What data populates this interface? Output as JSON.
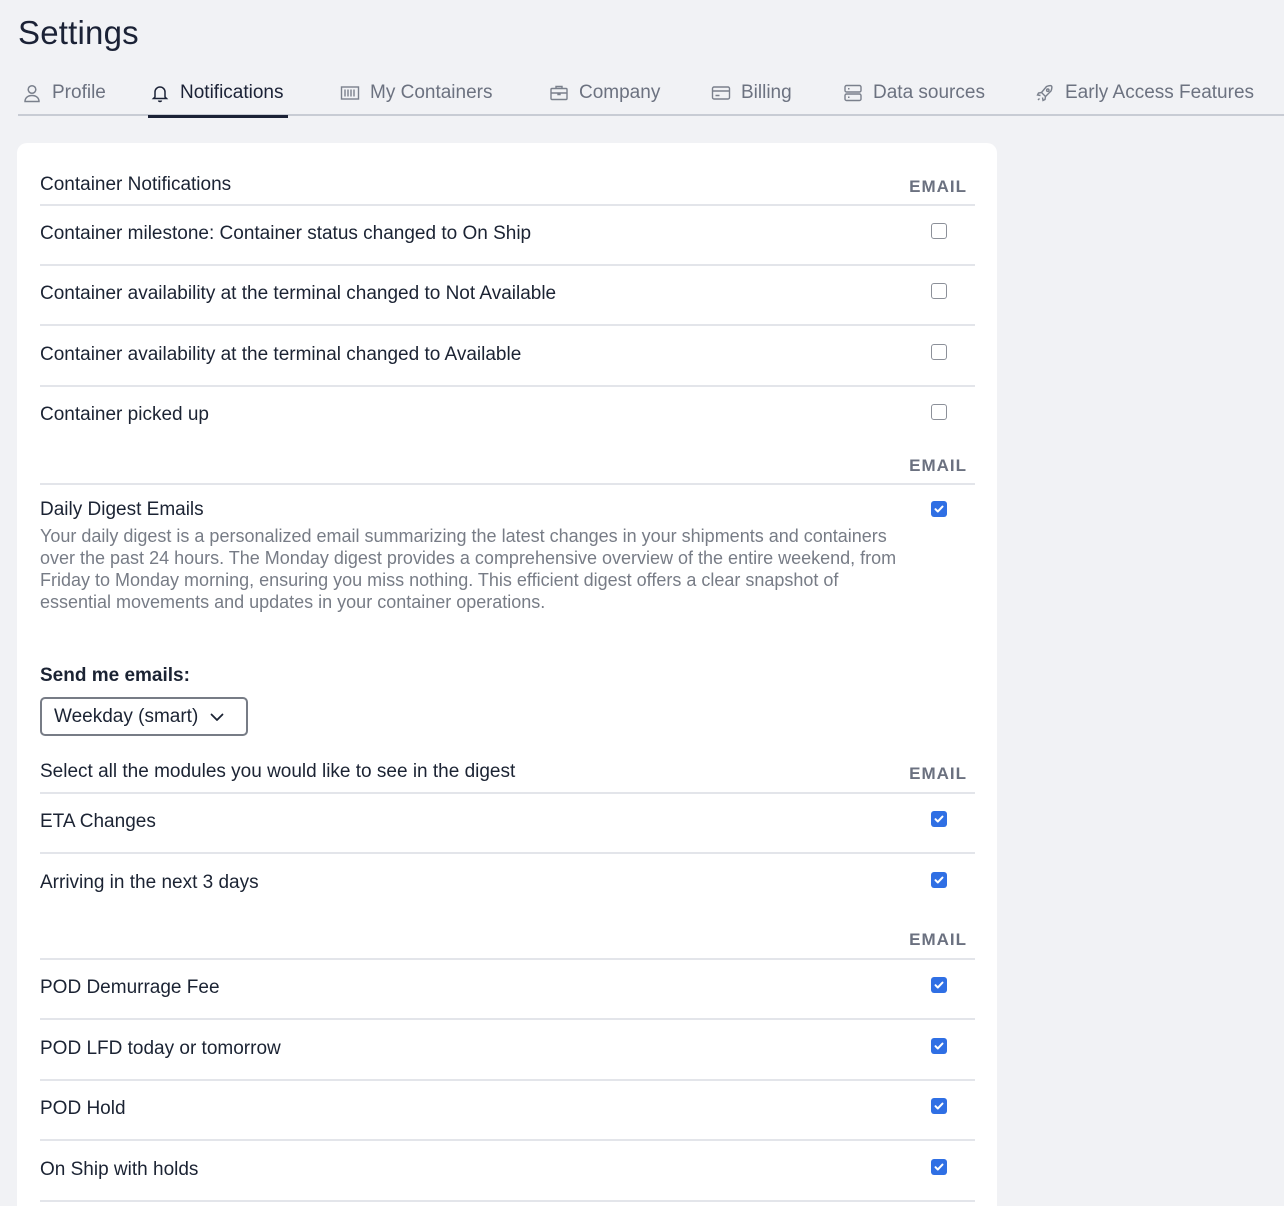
{
  "page_title": "Settings",
  "tabs": [
    {
      "label": "Profile",
      "icon": "user-icon",
      "active": false
    },
    {
      "label": "Notifications",
      "icon": "bell-icon",
      "active": true
    },
    {
      "label": "My Containers",
      "icon": "container-icon",
      "active": false
    },
    {
      "label": "Company",
      "icon": "briefcase-icon",
      "active": false
    },
    {
      "label": "Billing",
      "icon": "credit-card-icon",
      "active": false
    },
    {
      "label": "Data sources",
      "icon": "server-icon",
      "active": false
    },
    {
      "label": "Early Access Features",
      "icon": "rocket-icon",
      "active": false
    }
  ],
  "container_notifications": {
    "header": "Container Notifications",
    "column": "EMAIL",
    "items": [
      {
        "label": "Container milestone: Container status changed to On Ship",
        "checked": false
      },
      {
        "label": "Container availability at the terminal changed to Not Available",
        "checked": false
      },
      {
        "label": "Container availability at the terminal changed to Available",
        "checked": false
      },
      {
        "label": "Container picked up",
        "checked": false
      }
    ]
  },
  "daily_digest": {
    "column": "EMAIL",
    "title": "Daily Digest Emails",
    "description": "Your daily digest is a personalized email summarizing the latest changes in your shipments and containers over the past 24 hours. The Monday digest provides a comprehensive overview of the entire weekend, from Friday to Monday morning, ensuring you miss nothing. This efficient digest offers a clear snapshot of essential movements and updates in your container operations.",
    "checked": true,
    "send_label": "Send me emails:",
    "send_value": "Weekday (smart)"
  },
  "modules": {
    "header": "Select all the modules you would like to see in the digest",
    "column": "EMAIL",
    "items": [
      {
        "label": "ETA Changes",
        "checked": true
      },
      {
        "label": "Arriving in the next 3 days",
        "checked": true
      }
    ]
  },
  "pod_modules": {
    "column": "EMAIL",
    "items": [
      {
        "label": "POD Demurrage Fee",
        "checked": true
      },
      {
        "label": "POD LFD today or tomorrow",
        "checked": true
      },
      {
        "label": "POD Hold",
        "checked": true
      },
      {
        "label": "On Ship with holds",
        "checked": true
      }
    ]
  },
  "colors": {
    "accent": "#2f6fe4",
    "background": "#f1f2f5",
    "card": "#ffffff",
    "text": "#1b2236",
    "muted": "#6c7280"
  }
}
